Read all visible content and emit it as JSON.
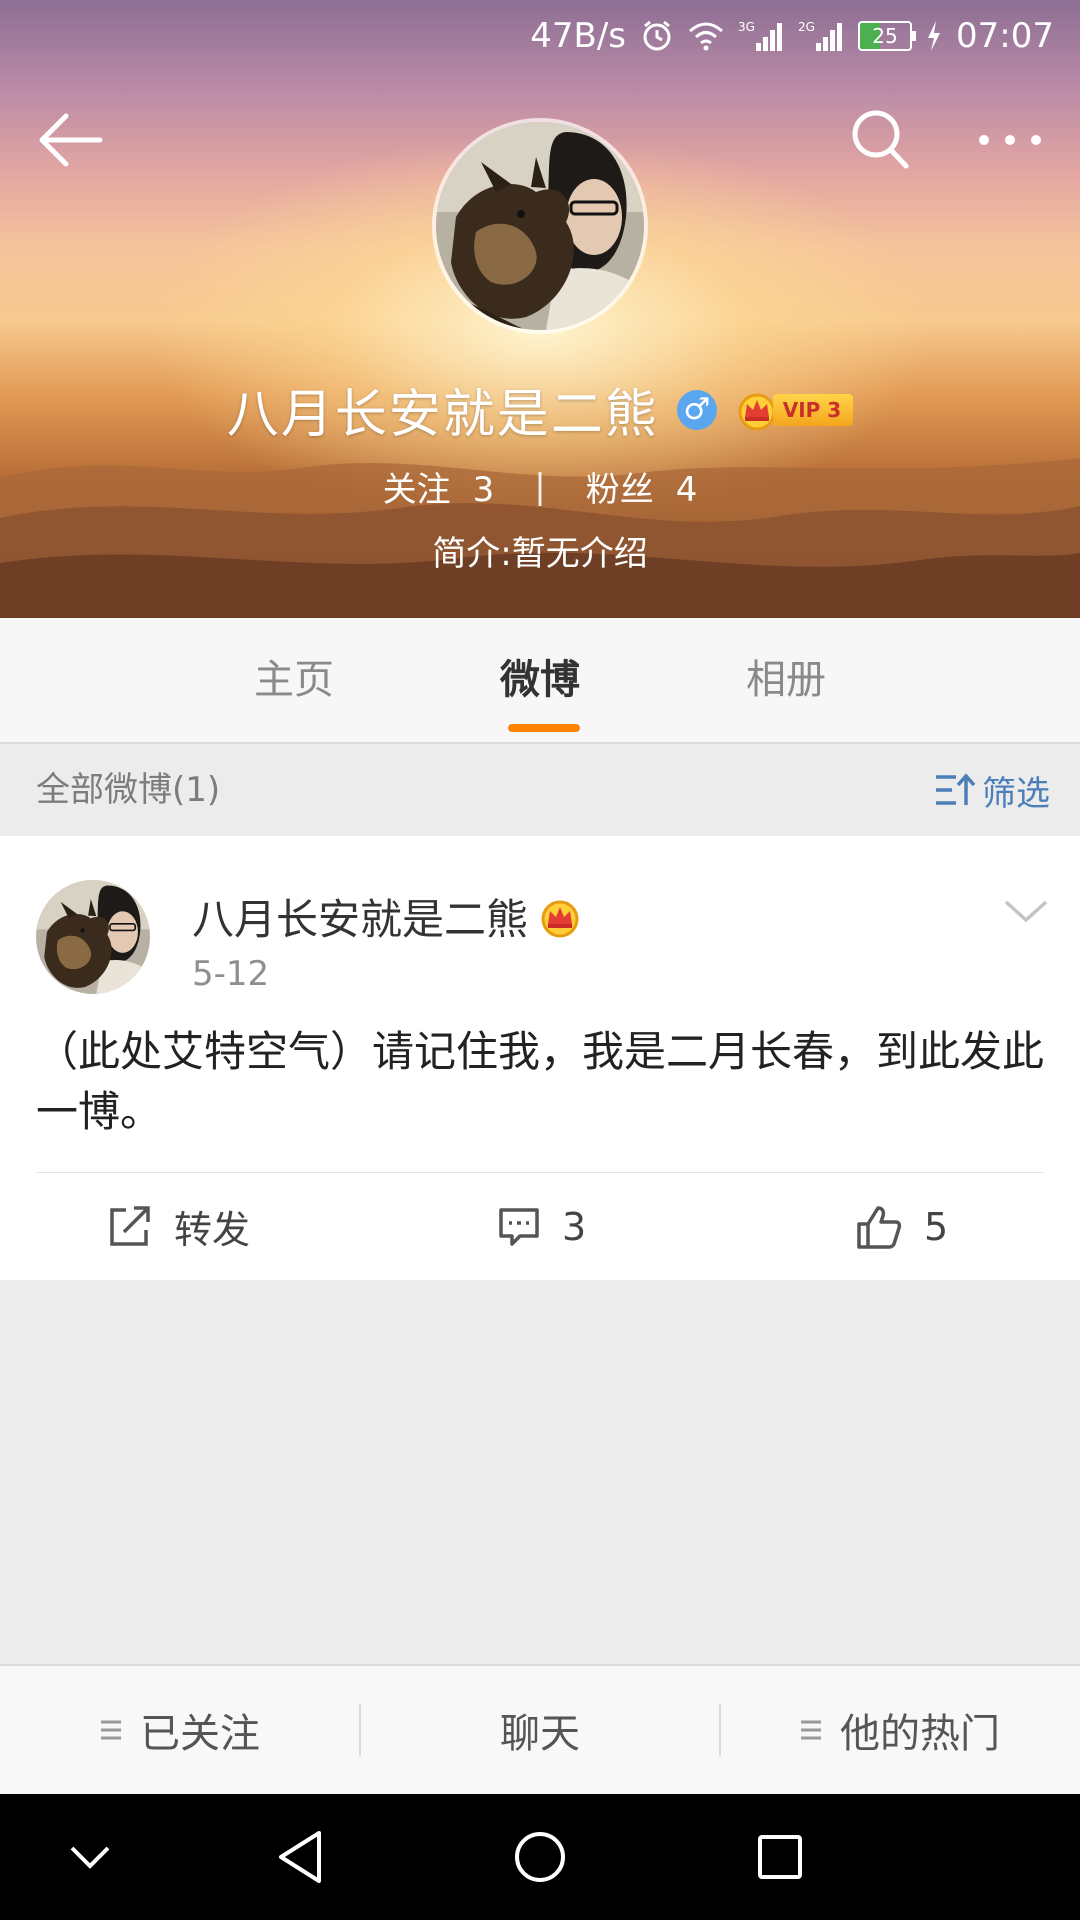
{
  "status_bar": {
    "net_speed": "47B/s",
    "sim1_label": "3G",
    "sim2_label": "2G",
    "battery": "25",
    "time": "07:07"
  },
  "profile": {
    "name": "八月长安就是二熊",
    "gender_symbol": "♂",
    "vip_label": "VIP 3",
    "following_label": "关注",
    "following_count": "3",
    "separator": "|",
    "followers_label": "粉丝",
    "followers_count": "4",
    "intro": "简介:暂无介绍"
  },
  "tabs": [
    {
      "label": "主页"
    },
    {
      "label": "微博",
      "active": true
    },
    {
      "label": "相册"
    }
  ],
  "filter": {
    "title": "全部微博(1)",
    "button_label": "筛选"
  },
  "post": {
    "author": "八月长安就是二熊",
    "date": "5-12",
    "text": "（此处艾特空气）请记住我，我是二月长春，到此发此一博。",
    "repost_label": "转发",
    "comment_count": "3",
    "like_count": "5"
  },
  "bottom_bar": {
    "followed_label": "已关注",
    "chat_label": "聊天",
    "hot_label": "他的热门"
  },
  "colors": {
    "accent_orange": "#ff8200",
    "link_blue": "#4a7fb8",
    "gender_blue": "#5aa7ef",
    "vip_gold": "#f4a51c"
  }
}
